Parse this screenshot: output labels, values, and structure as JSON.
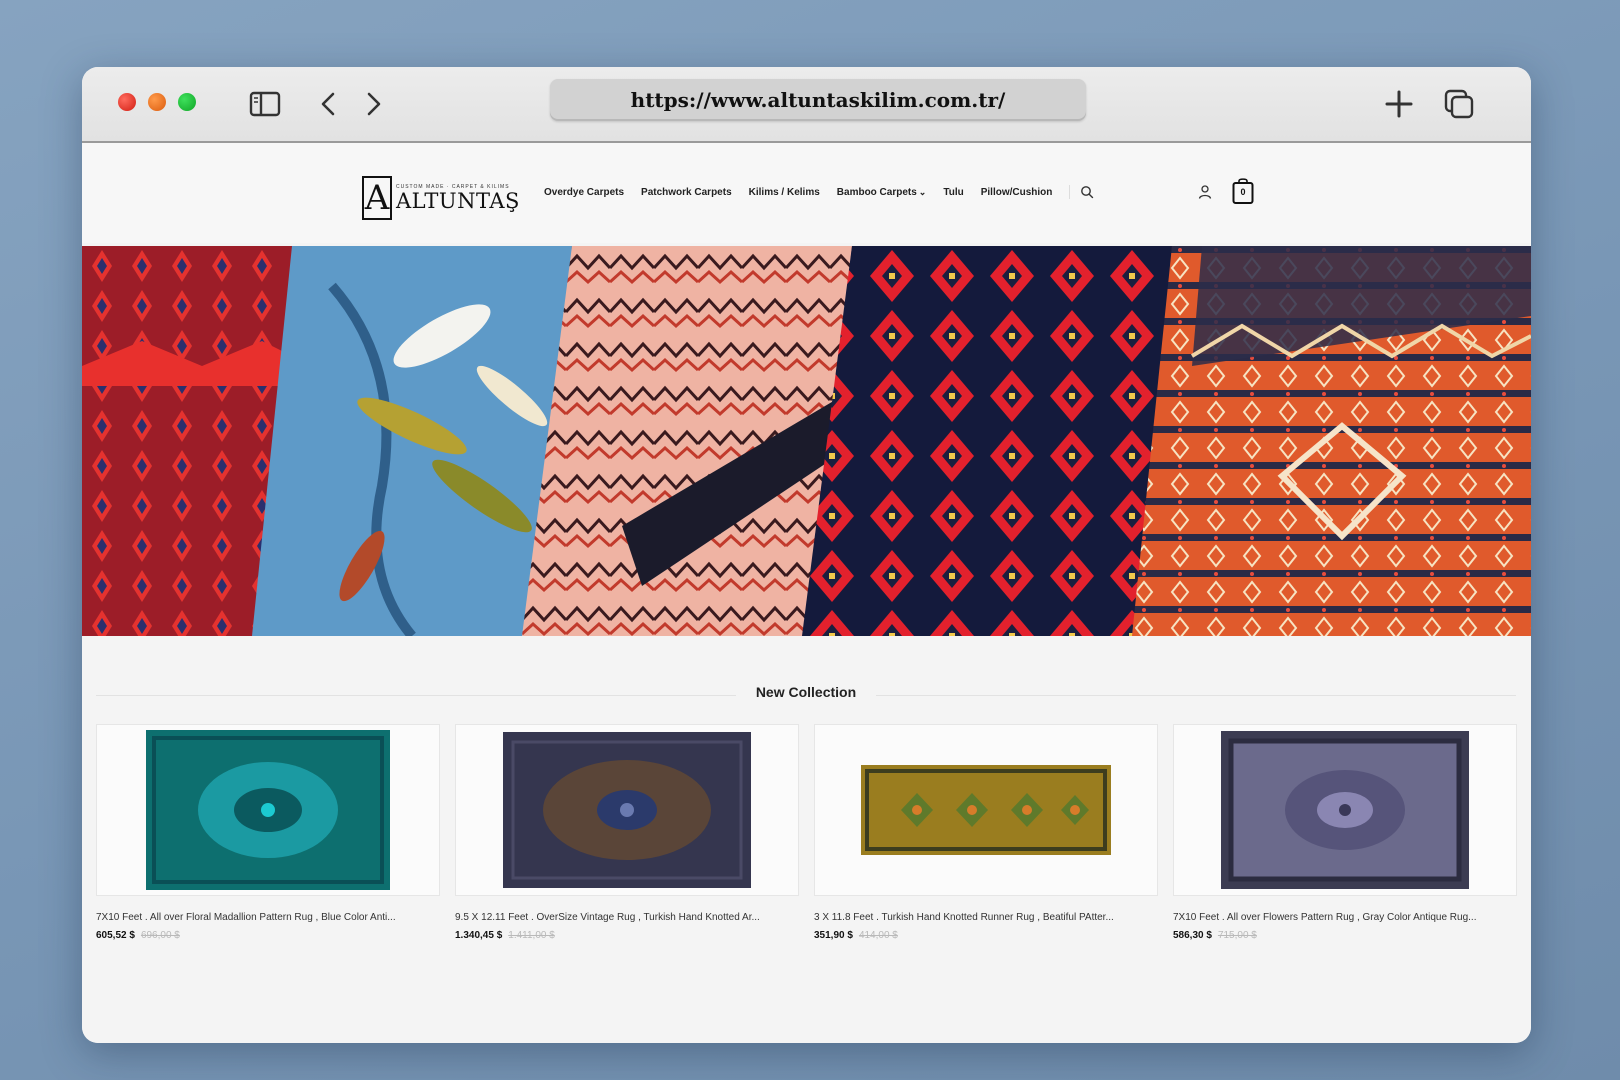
{
  "browser": {
    "url": "https://www.altuntaskilim.com.tr/",
    "icons": [
      "sidebar-icon",
      "chevron-left-icon",
      "chevron-right-icon",
      "plus-icon",
      "tabs-icon"
    ]
  },
  "site": {
    "logo": {
      "mark": "A",
      "tagline": "CUSTOM MADE · CARPET & KILIMS",
      "name": "ALTUNTAŞ"
    },
    "nav": [
      {
        "label": "Overdye Carpets"
      },
      {
        "label": "Patchwork Carpets"
      },
      {
        "label": "Kilims / Kelims"
      },
      {
        "label": "Bamboo Carpets",
        "caret": "⌄"
      },
      {
        "label": "Tulu"
      },
      {
        "label": "Pillow/Cushion"
      }
    ],
    "cart_count": "0",
    "section_title": "New Collection",
    "products": [
      {
        "title": "7X10 Feet . All over Floral Madallion Pattern Rug , Blue Color Anti...",
        "price": "605,52 $",
        "old_price": "696,00 $",
        "color": "#0f7f86"
      },
      {
        "title": "9.5 X 12.11 Feet . OverSize Vintage Rug , Turkish Hand Knotted Ar...",
        "price": "1.340,45 $",
        "old_price": "1.411,00 $",
        "color": "#3c3d5a"
      },
      {
        "title": "3 X 11.8 Feet . Turkish Hand Knotted Runner Rug , Beatiful PAtter...",
        "price": "351,90 $",
        "old_price": "414,00 $",
        "color": "#a88f26"
      },
      {
        "title": "7X10 Feet . All over Flowers Pattern Rug , Gray Color Antique Rug...",
        "price": "586,30 $",
        "old_price": "715,00 $",
        "color": "#6b6a8c"
      }
    ]
  }
}
